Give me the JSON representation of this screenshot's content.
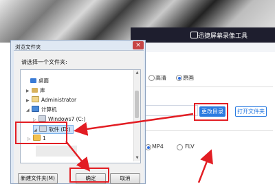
{
  "app": {
    "title": "迅捷屏幕录像工具",
    "quality": {
      "option_hd": "高清",
      "option_original": "原画",
      "selected": "原画"
    },
    "buttons": {
      "change_dir": "更改目录",
      "open_folder": "打开文件夹"
    },
    "format": {
      "option_mp4": "MP4",
      "option_flv": "FLV"
    }
  },
  "dialog": {
    "title": "浏览文件夹",
    "close_glyph": "×",
    "prompt": "请选择一个文件夹:",
    "tree": [
      {
        "label": "桌面",
        "icon": "desktop-icon"
      },
      {
        "label": "库",
        "icon": "library-icon"
      },
      {
        "label": "Administrator",
        "icon": "user-folder-icon"
      },
      {
        "label": "计算机",
        "icon": "computer-icon"
      },
      {
        "label": "Windows7 (C:)",
        "icon": "drive-icon"
      },
      {
        "label": "软件 (D:)",
        "icon": "drive-icon"
      },
      {
        "label": "1",
        "icon": "folder-icon"
      }
    ],
    "buttons": {
      "new_folder": "新建文件夹(M)",
      "ok": "确定",
      "cancel": "取消"
    }
  },
  "colors": {
    "accent": "#2b7be0",
    "annotation": "#e21d23",
    "titlebar": "#1e1e2e"
  }
}
